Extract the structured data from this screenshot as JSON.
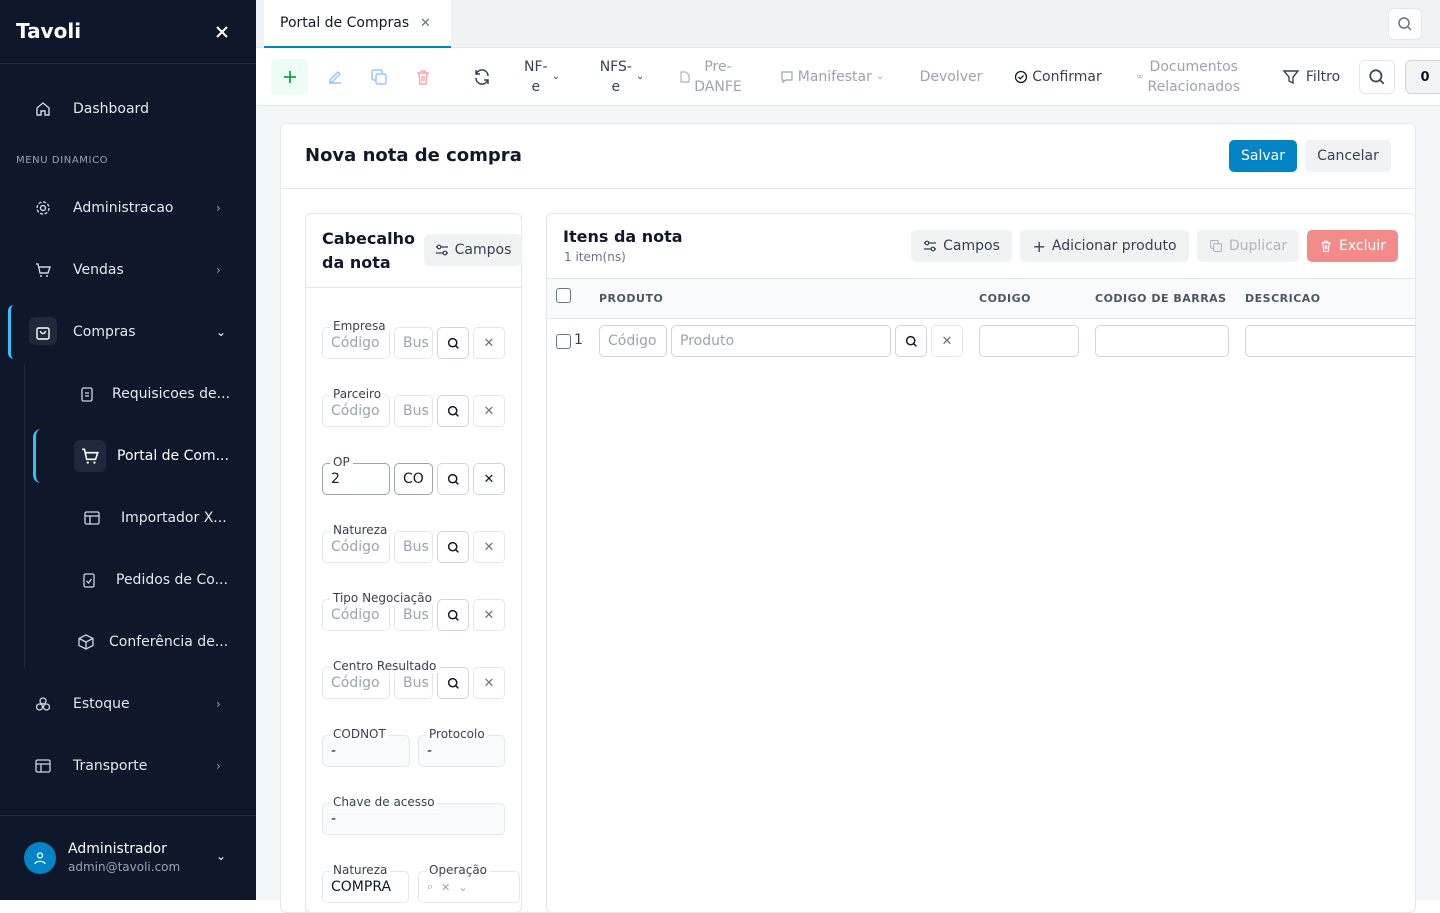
{
  "app": {
    "brand": "Tavoli"
  },
  "sidebar": {
    "dashboard": "Dashboard",
    "menu_header": "MENU DINAMICO",
    "items": [
      {
        "label": "Administracao"
      },
      {
        "label": "Vendas"
      },
      {
        "label": "Compras"
      },
      {
        "label": "Estoque"
      },
      {
        "label": "Transporte"
      }
    ],
    "compras_sub": [
      {
        "label": "Requisicoes de..."
      },
      {
        "label": "Portal de Com..."
      },
      {
        "label": "Importador X..."
      },
      {
        "label": "Pedidos de Co..."
      },
      {
        "label": "Conferência de..."
      }
    ],
    "user": {
      "name": "Administrador",
      "email": "admin@tavoli.com"
    }
  },
  "tabs": [
    {
      "label": "Portal de Compras"
    }
  ],
  "toolbar": {
    "nfe": "NF-\ne",
    "nfse": "NFS-\ne",
    "predanfe": "Pre-\nDANFE",
    "manifestar": "Manifestar",
    "devolver": "Devolver",
    "confirmar": "Confirmar",
    "documentos": "Documentos\nRelacionados",
    "filtro": "Filtro",
    "count": "0"
  },
  "form": {
    "title": "Nova nota de compra",
    "save": "Salvar",
    "cancel": "Cancelar"
  },
  "header_panel": {
    "title": "Cabecalho da nota",
    "campos": "Campos",
    "fields": {
      "empresa": {
        "label": "Empresa",
        "code_placeholder": "Código",
        "search_placeholder": "Bus"
      },
      "parceiro": {
        "label": "Parceiro",
        "code_placeholder": "Código",
        "search_placeholder": "Bus"
      },
      "op": {
        "label": "OP",
        "value": "2",
        "desc": "CO"
      },
      "natureza": {
        "label": "Natureza",
        "code_placeholder": "Código",
        "search_placeholder": "Bus"
      },
      "tipo_negociacao": {
        "label": "Tipo Negociação",
        "code_placeholder": "Código",
        "search_placeholder": "Bus"
      },
      "centro_resultado": {
        "label": "Centro Resultado",
        "code_placeholder": "Código",
        "search_placeholder": "Bus"
      },
      "codnot": {
        "label": "CODNOT",
        "value": "-"
      },
      "protocolo": {
        "label": "Protocolo",
        "value": "-"
      },
      "chave": {
        "label": "Chave de acesso",
        "value": "-"
      },
      "natureza2": {
        "label": "Natureza",
        "value": "COMPRA"
      },
      "operacao": {
        "label": "Operação"
      }
    }
  },
  "items_panel": {
    "title": "Itens da nota",
    "subtitle": "1 item(ns)",
    "campos": "Campos",
    "add": "Adicionar produto",
    "duplicate": "Duplicar",
    "delete": "Excluir",
    "columns": [
      "PRODUTO",
      "CODIGO",
      "CODIGO DE BARRAS",
      "DESCRICAO"
    ],
    "rows": [
      {
        "index": "1",
        "code_placeholder": "Código",
        "product_placeholder": "Produto"
      }
    ]
  }
}
